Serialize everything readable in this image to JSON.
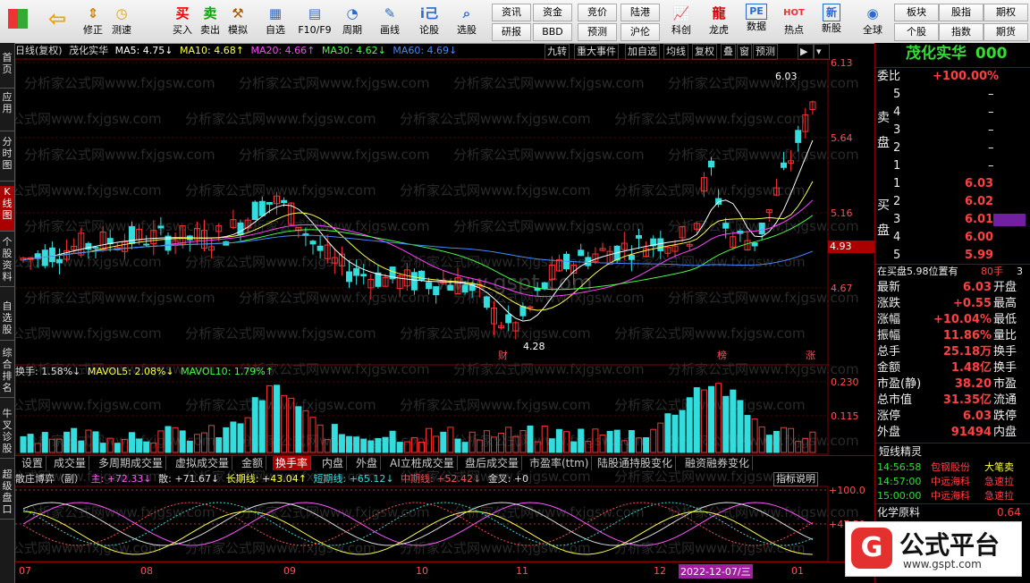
{
  "toolbar": {
    "buttons": [
      {
        "label": "",
        "icon": "grid-icon"
      },
      {
        "label": "",
        "icon": "back-arrow-icon"
      },
      {
        "label": "修正",
        "icon": "up-down-icon"
      },
      {
        "label": "测速",
        "icon": "stopwatch-icon"
      },
      {
        "label": "买入",
        "icon": "buy-icon"
      },
      {
        "label": "卖出",
        "icon": "sell-icon"
      },
      {
        "label": "模拟",
        "icon": "hammer-icon"
      },
      {
        "label": "自选",
        "icon": "star-icon"
      },
      {
        "label": "F10/F9",
        "icon": "f10-icon"
      },
      {
        "label": "周期",
        "icon": "clock-icon"
      },
      {
        "label": "画线",
        "icon": "pencil-icon"
      },
      {
        "label": "论股",
        "icon": "chat-icon"
      },
      {
        "label": "选股",
        "icon": "magnifier-icon"
      },
      {
        "label": "科创",
        "icon": "chart-icon"
      },
      {
        "label": "龙虎",
        "icon": "dragon-icon"
      },
      {
        "label": "数据",
        "icon": "pe-icon"
      },
      {
        "label": "热点",
        "icon": "fire-icon"
      },
      {
        "label": "新股",
        "icon": "ipo-icon"
      },
      {
        "label": "全球",
        "icon": "globe-icon"
      }
    ],
    "small_top": [
      "资讯",
      "资金",
      "竞价",
      "陆港",
      "板块",
      "股指",
      "期权"
    ],
    "small_bottom": [
      "研报",
      "BBD",
      "预测",
      "沪伦",
      "个股",
      "指数",
      "期货"
    ],
    "buy_glyph": "买",
    "sell_glyph": "卖",
    "info_glyph": "i己",
    "pe_glyph": "PE",
    "hot_glyph": "HOT",
    "new_glyph": "新"
  },
  "sidebar": [
    {
      "label": "首页",
      "active": false
    },
    {
      "label": "应用",
      "active": false
    },
    {
      "label": "分时图",
      "active": false
    },
    {
      "label": "K线图",
      "active": true
    },
    {
      "label": "个股资料",
      "active": false
    },
    {
      "label": "自选股",
      "active": false
    },
    {
      "label": "综合排名",
      "active": false
    },
    {
      "label": "牛叉诊股",
      "active": false
    },
    {
      "label": "超级盘口",
      "active": false
    }
  ],
  "chart_header": {
    "title": "日线(复权)",
    "name": "茂化实华",
    "ma5": "MA5: 4.75↓",
    "ma10": "MA10: 4.68↑",
    "ma20": "MA20: 4.66↑",
    "ma30": "MA30: 4.62↓",
    "ma60": "MA60: 4.69↓",
    "buttons": [
      "九转",
      "重大事件",
      "加自选",
      "均线",
      "复权",
      "叠",
      "窗",
      "预测"
    ]
  },
  "price_axis": [
    "6.13",
    "5.64",
    "5.16",
    "4.67"
  ],
  "current_price_tag": "4.93",
  "annotations": {
    "high": "6.03",
    "low": "4.28",
    "cai": "财",
    "bang": "榜",
    "zhang": "涨"
  },
  "watermark": "分析家公式网www.fxjgsw.com",
  "watermark_center": "www.gspt.com",
  "volume_header": {
    "hs": "换手: 1.58%↓",
    "mavol5": "MAVOL5: 2.08%↓",
    "mavol10": "MAVOL10: 1.79%↑"
  },
  "volume_axis": [
    "0.230",
    "0.115"
  ],
  "tabs": [
    "设置",
    "成交量",
    "多周期成交量",
    "虚拟成交量",
    "金额",
    "换手率",
    "内盘",
    "外盘",
    "AI立桩成交量",
    "盘后成交量",
    "市盈率(ttm)",
    "陆股通持股变化",
    "融资融券变化"
  ],
  "active_tab": "换手率",
  "indicator_header": {
    "name": "散庄博弈（副）",
    "zhu": "主: +72.33↓",
    "san": "散: +71.67↓",
    "chang": "长期线: +43.04↑",
    "duan": "短期线: +65.12↓",
    "zhong": "中期线: +52.42↓",
    "jinxia": "金叉: +0",
    "help": "指标说明"
  },
  "indicator_axis": [
    "+100.0",
    "+47.50"
  ],
  "date_axis": [
    "07",
    "08",
    "09",
    "10",
    "11",
    "12",
    "01"
  ],
  "date_cursor": "2022-12-07/三",
  "right_panel": {
    "stock_name": "茂化实华",
    "stock_code": "000",
    "weibi_label": "委比",
    "weibi_value": "+100.00%",
    "sell_label": "卖盘",
    "buy_label": "买盘",
    "sell_levels": [
      {
        "n": "5",
        "p": "",
        "v": "–"
      },
      {
        "n": "4",
        "p": "",
        "v": "–"
      },
      {
        "n": "3",
        "p": "",
        "v": "–"
      },
      {
        "n": "2",
        "p": "",
        "v": "–"
      },
      {
        "n": "1",
        "p": "",
        "v": "–"
      }
    ],
    "buy_levels": [
      {
        "n": "1",
        "p": "6.03"
      },
      {
        "n": "2",
        "p": "6.02"
      },
      {
        "n": "3",
        "p": "6.01"
      },
      {
        "n": "4",
        "p": "6.00"
      },
      {
        "n": "5",
        "p": "5.99"
      }
    ],
    "status": "在买盘5.98位置有",
    "status_vol": "80手",
    "status_extra": "3",
    "stats": [
      {
        "k": "最新",
        "v": "6.03",
        "k2": "开盘"
      },
      {
        "k": "涨跌",
        "v": "+0.55",
        "k2": "最高"
      },
      {
        "k": "涨幅",
        "v": "+10.04%",
        "k2": "最低"
      },
      {
        "k": "振幅",
        "v": "11.86%",
        "k2": "量比"
      },
      {
        "k": "总手",
        "v": "25.18万",
        "k2": "换手"
      },
      {
        "k": "金额",
        "v": "1.48亿",
        "k2": "换手"
      },
      {
        "k": "市盈(静)",
        "v": "38.20",
        "k2": "市盈"
      },
      {
        "k": "总市值",
        "v": "31.35亿",
        "k2": "流通"
      },
      {
        "k": "涨停",
        "v": "6.03",
        "k2": "跌停"
      },
      {
        "k": "外盘",
        "v": "91494",
        "k2": "内盘"
      }
    ],
    "short_title": "短线精灵",
    "short_items": [
      {
        "t": "14:56:58",
        "n": "包钢股份",
        "e": "大笔卖"
      },
      {
        "t": "14:57:00",
        "n": "中远海科",
        "e": "急速拉"
      },
      {
        "t": "15:00:00",
        "n": "中远海科",
        "e": "急速拉"
      }
    ],
    "sector_name": "化学原料",
    "sector_value": "0.64"
  },
  "logo": {
    "text": "公式平台",
    "url": "www.gspt.com",
    "glyph": "G"
  },
  "colors": {
    "up": "#ff3333",
    "down": "#33dddd",
    "ma5": "#ffffff",
    "ma10": "#ffff44",
    "ma20": "#ff44ff",
    "ma30": "#44ff44",
    "ma60": "#4488ff"
  }
}
